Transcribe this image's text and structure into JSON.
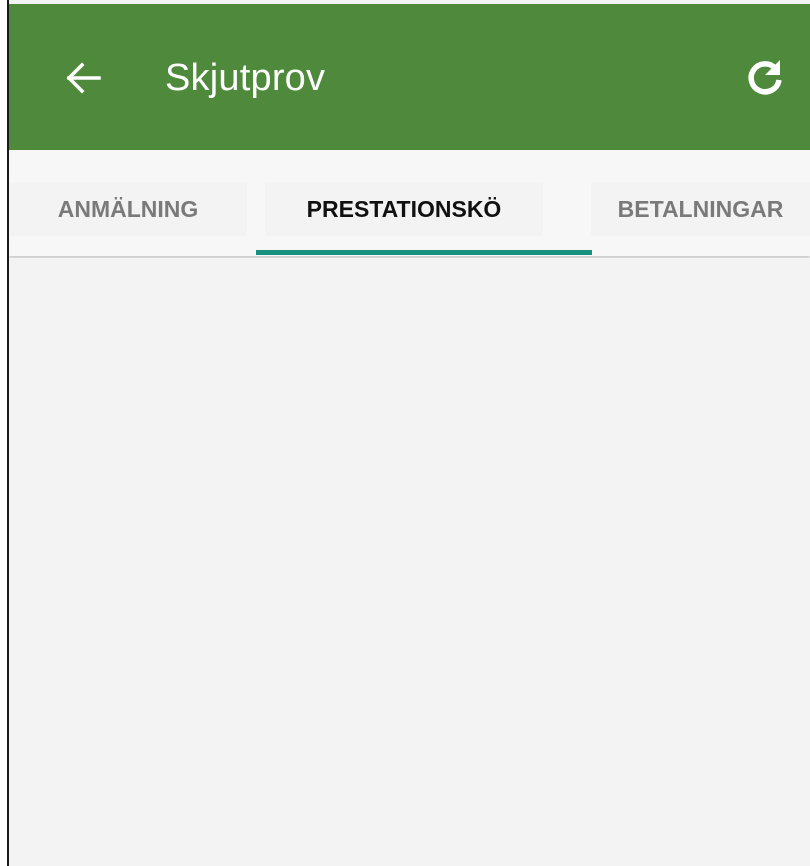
{
  "header": {
    "title": "Skjutprov",
    "back_icon": "arrow-left-icon",
    "refresh_icon": "refresh-icon",
    "bar_color": "#4f8a3c"
  },
  "tabs": [
    {
      "label": "ANMÄLNING",
      "selected": false
    },
    {
      "label": "PRESTATIONSKÖ",
      "selected": true
    },
    {
      "label": "BETALNINGAR",
      "selected": false
    }
  ],
  "colors": {
    "accent": "#17907f",
    "background": "#f3f3f3"
  }
}
